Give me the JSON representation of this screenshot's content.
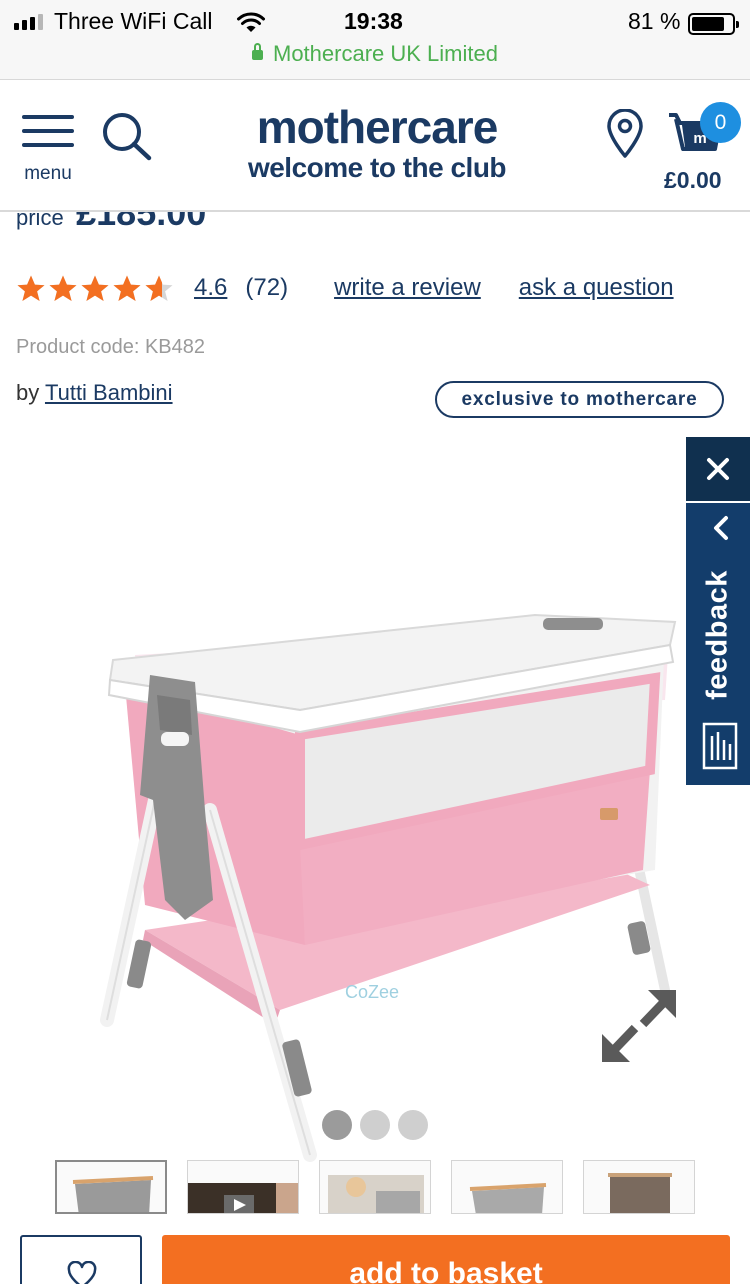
{
  "status_bar": {
    "carrier": "Three WiFi Call",
    "time": "19:38",
    "battery": "81 %",
    "battery_level": 0.81,
    "secure_site": "Mothercare UK Limited"
  },
  "header": {
    "menu_label": "menu",
    "logo_main": "mothercare",
    "logo_tagline": "welcome to the club",
    "basket_count": "0",
    "basket_total": "£0.00"
  },
  "product": {
    "price_label": "price",
    "price": "£185.00",
    "rating": "4.6",
    "rating_value": 4.6,
    "review_count": "(72)",
    "write_review": "write a review",
    "ask_question": "ask a question",
    "product_code": "Product code: KB482",
    "by_label": "by",
    "brand": "Tutti Bambini",
    "exclusive_badge": "exclusive to mothercare"
  },
  "gallery": {
    "dot_count": 3,
    "active_dot": 0,
    "thumbnail_count": 5,
    "active_thumbnail": 0
  },
  "feedback": {
    "label": "feedback"
  },
  "actions": {
    "add_to_basket": "add to basket"
  },
  "colors": {
    "brand_navy": "#1b3a63",
    "accent_orange": "#f36f21",
    "star_orange": "#f36f21",
    "badge_blue": "#1e8fe0",
    "secure_green": "#4caf50",
    "feedback_navy": "#133d6b"
  },
  "icons": {
    "menu": "hamburger-icon",
    "search": "search-icon",
    "store_locator": "location-pin-icon",
    "basket": "basket-icon",
    "expand": "expand-icon",
    "close": "close-icon",
    "chevron": "chevron-left-icon",
    "feedback": "feedback-icon",
    "wishlist": "heart-icon"
  }
}
